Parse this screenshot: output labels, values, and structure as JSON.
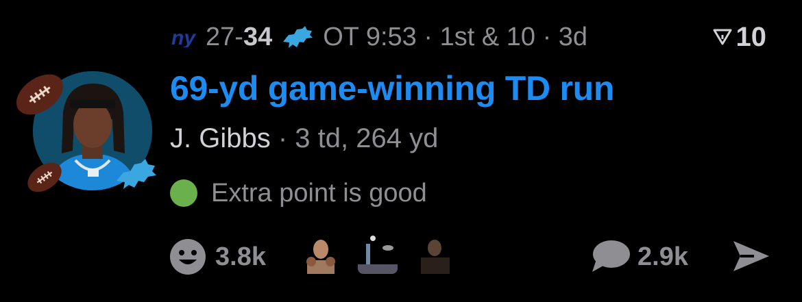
{
  "game": {
    "away_team_logo": "giants-logo-icon",
    "away_score": "27",
    "separator": "-",
    "home_score": "34",
    "home_team_logo": "lions-logo-icon",
    "game_state": "OT 9:53 · 1st & 10 · 3d"
  },
  "rank": {
    "icon": "vote-arrow-icon",
    "value": "10"
  },
  "play": {
    "headline": "69-yd game-winning TD run",
    "player_name": "J. Gibbs",
    "player_stats": " · 3 td, 264 yd",
    "status_color": "#6ab04c",
    "status_text": "Extra point is good"
  },
  "footer": {
    "reactions_count": "3.8k",
    "comments_count": "2.9k"
  },
  "colors": {
    "headline": "#1c8cf2",
    "muted": "#8e8e93",
    "background": "#000000"
  }
}
